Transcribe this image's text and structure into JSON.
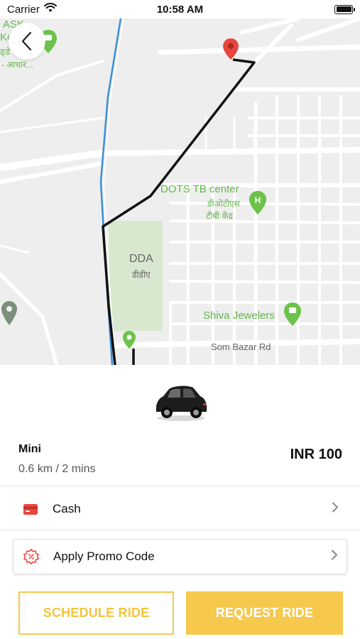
{
  "status_bar": {
    "carrier": "Carrier",
    "time": "10:58 AM"
  },
  "map": {
    "labels": {
      "ask_1": "ASK -",
      "ask_2": "Ke",
      "ask_3": "ङ्डे",
      "ask_4": "- आधार...",
      "dots": "DOTS TB center",
      "dots_hindi_1": "डीओटीएस",
      "dots_hindi_2": "टीबी केंद्र",
      "dda": "DDA",
      "dda_hindi": "डीडीए",
      "shiva": "Shiva Jewelers",
      "som_bazar": "Som Bazar Rd"
    },
    "colors": {
      "route": "#111111",
      "rail": "#3a8fd6",
      "park": "#d7e9cf",
      "road": "#ffffff",
      "pin_red": "#e8453c",
      "pin_green": "#6cc24a"
    }
  },
  "ride": {
    "icon": "car-image",
    "name": "Mini",
    "distance_time": "0.6 km / 2 mins",
    "price": "INR 100"
  },
  "payment": {
    "icon": "credit-card-icon",
    "label": "Cash"
  },
  "promo": {
    "icon": "discount-badge-icon",
    "label": "Apply Promo Code"
  },
  "buttons": {
    "schedule": "SCHEDULE RIDE",
    "request": "REQUEST RIDE"
  },
  "theme": {
    "accent": "#f6c94d",
    "card_red": "#e8453c"
  }
}
